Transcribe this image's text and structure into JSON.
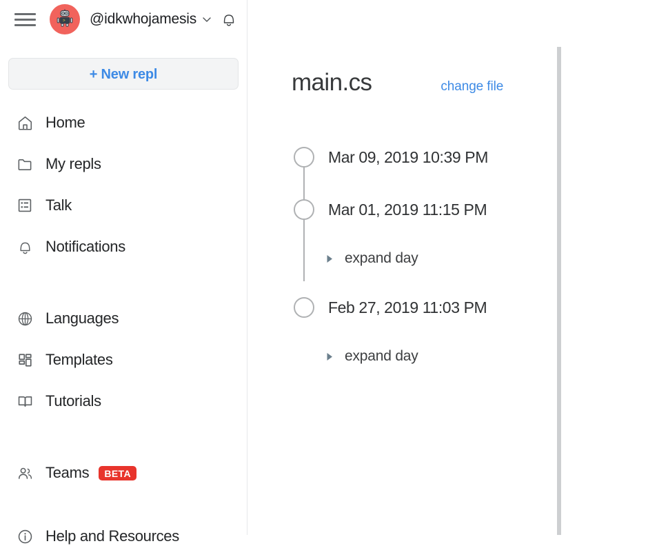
{
  "header": {
    "menu_icon": "hamburger-menu-icon",
    "avatar_icon": "robot-avatar",
    "username": "@idkwhojamesis",
    "chevron_icon": "chevron-down-icon",
    "bell_icon": "bell-icon",
    "avatar_bg": "#f1635c"
  },
  "sidebar": {
    "new_repl_label": "+ New repl",
    "accent_color": "#3d8ae5",
    "badge_color": "#e8342c",
    "groups": [
      {
        "items": [
          {
            "label": "Home",
            "icon": "home-icon"
          },
          {
            "label": "My repls",
            "icon": "folder-icon"
          },
          {
            "label": "Talk",
            "icon": "list-box-icon"
          },
          {
            "label": "Notifications",
            "icon": "bell-icon"
          }
        ]
      },
      {
        "items": [
          {
            "label": "Languages",
            "icon": "globe-icon"
          },
          {
            "label": "Templates",
            "icon": "grid-icon"
          },
          {
            "label": "Tutorials",
            "icon": "book-icon"
          }
        ]
      },
      {
        "items": [
          {
            "label": "Teams",
            "icon": "users-icon",
            "badge": "BETA"
          }
        ]
      },
      {
        "items": [
          {
            "label": "Help and Resources",
            "icon": "info-icon"
          }
        ]
      }
    ]
  },
  "main": {
    "file_title": "main.cs",
    "change_file_label": "change file",
    "timeline": [
      {
        "date": "Mar 09, 2019 10:39 PM"
      },
      {
        "date": "Mar 01, 2019 11:15 PM",
        "expand_label": "expand day",
        "caret_icon": "caret-right-icon"
      },
      {
        "date": "Feb 27, 2019 11:03 PM",
        "expand_label": "expand day",
        "caret_icon": "caret-right-icon"
      }
    ]
  }
}
